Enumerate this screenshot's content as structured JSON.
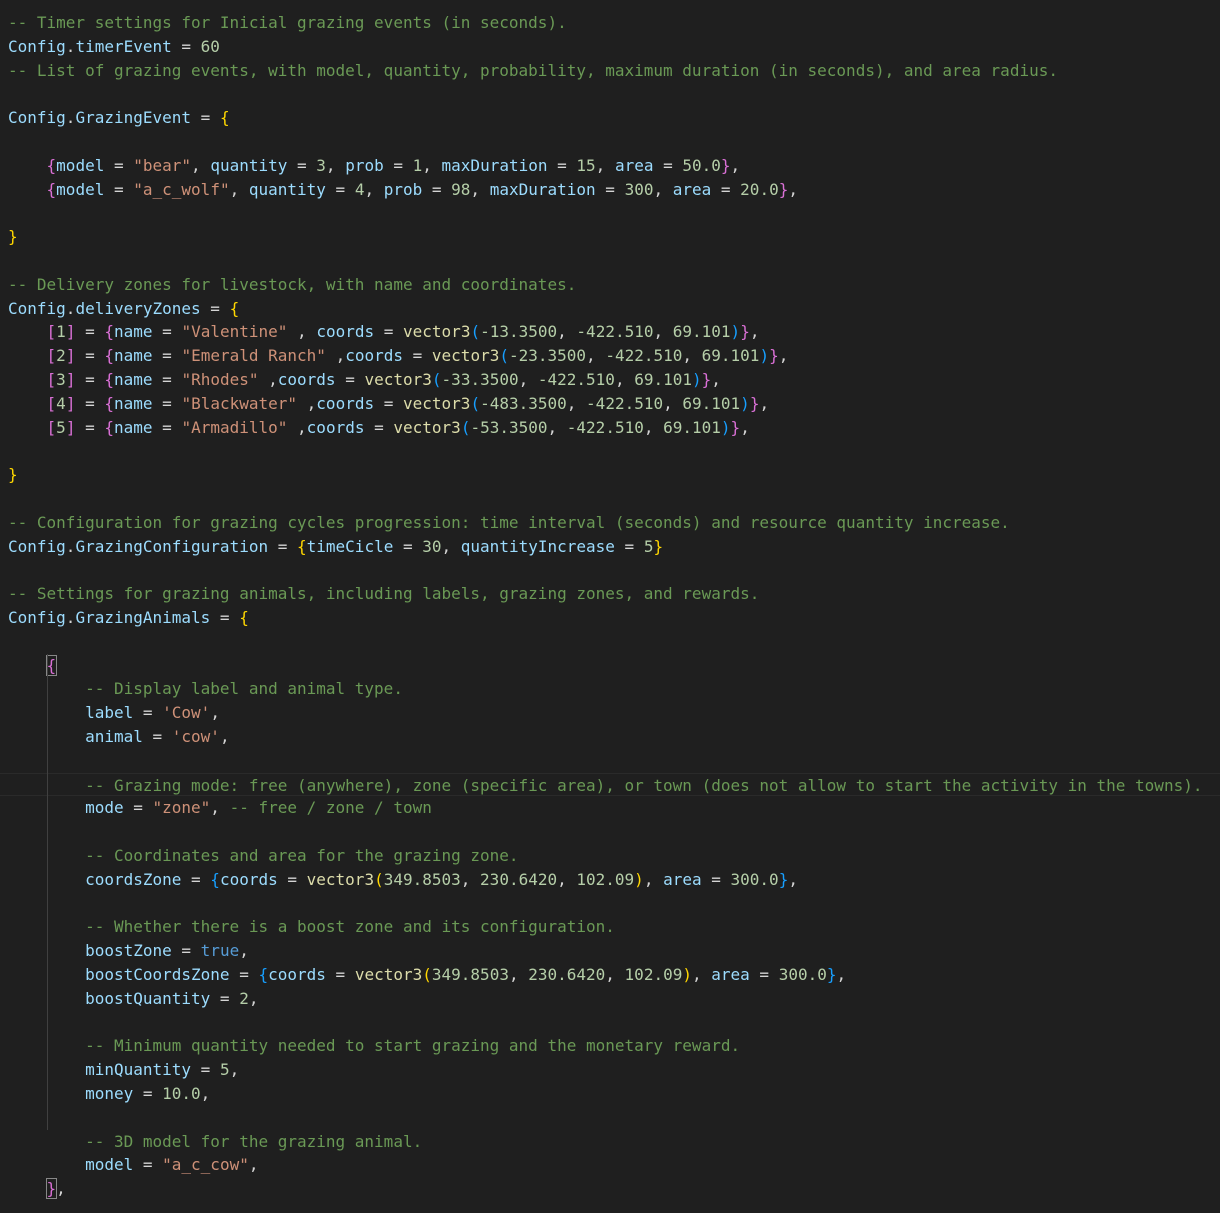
{
  "editor": {
    "theme": {
      "background": "#1f1f1f",
      "comment": "#6a9955",
      "variable": "#9cdcfe",
      "string": "#ce9178",
      "number": "#b5cea8",
      "function": "#dcdcaa",
      "boolean": "#569cd6",
      "bracket1": "#ffd700",
      "bracket2": "#da70d6",
      "bracket3": "#179fff"
    },
    "lines": [
      [
        [
          "comment",
          "-- Timer settings for Inicial grazing events (in seconds)."
        ]
      ],
      [
        [
          "var",
          "Config"
        ],
        [
          "op",
          "."
        ],
        [
          "prop",
          "timerEvent"
        ],
        [
          "op",
          " = "
        ],
        [
          "num",
          "60"
        ]
      ],
      [
        [
          "comment",
          "-- List of grazing events, with model, quantity, probability, maximum duration (in seconds), and area radius."
        ]
      ],
      [],
      [
        [
          "var",
          "Config"
        ],
        [
          "op",
          "."
        ],
        [
          "prop",
          "GrazingEvent"
        ],
        [
          "op",
          " = "
        ],
        [
          "b1",
          "{"
        ]
      ],
      [],
      [
        [
          "op",
          "    "
        ],
        [
          "b2",
          "{"
        ],
        [
          "prop",
          "model"
        ],
        [
          "op",
          " = "
        ],
        [
          "str",
          "\"bear\""
        ],
        [
          "op",
          ", "
        ],
        [
          "prop",
          "quantity"
        ],
        [
          "op",
          " = "
        ],
        [
          "num",
          "3"
        ],
        [
          "op",
          ", "
        ],
        [
          "prop",
          "prob"
        ],
        [
          "op",
          " = "
        ],
        [
          "num",
          "1"
        ],
        [
          "op",
          ", "
        ],
        [
          "prop",
          "maxDuration"
        ],
        [
          "op",
          " = "
        ],
        [
          "num",
          "15"
        ],
        [
          "op",
          ", "
        ],
        [
          "prop",
          "area"
        ],
        [
          "op",
          " = "
        ],
        [
          "num",
          "50.0"
        ],
        [
          "b2",
          "}"
        ],
        [
          "op",
          ","
        ]
      ],
      [
        [
          "op",
          "    "
        ],
        [
          "b2",
          "{"
        ],
        [
          "prop",
          "model"
        ],
        [
          "op",
          " = "
        ],
        [
          "str",
          "\"a_c_wolf\""
        ],
        [
          "op",
          ", "
        ],
        [
          "prop",
          "quantity"
        ],
        [
          "op",
          " = "
        ],
        [
          "num",
          "4"
        ],
        [
          "op",
          ", "
        ],
        [
          "prop",
          "prob"
        ],
        [
          "op",
          " = "
        ],
        [
          "num",
          "98"
        ],
        [
          "op",
          ", "
        ],
        [
          "prop",
          "maxDuration"
        ],
        [
          "op",
          " = "
        ],
        [
          "num",
          "300"
        ],
        [
          "op",
          ", "
        ],
        [
          "prop",
          "area"
        ],
        [
          "op",
          " = "
        ],
        [
          "num",
          "20.0"
        ],
        [
          "b2",
          "}"
        ],
        [
          "op",
          ","
        ]
      ],
      [],
      [
        [
          "b1",
          "}"
        ]
      ],
      [],
      [
        [
          "comment",
          "-- Delivery zones for livestock, with name and coordinates."
        ]
      ],
      [
        [
          "var",
          "Config"
        ],
        [
          "op",
          "."
        ],
        [
          "prop",
          "deliveryZones"
        ],
        [
          "op",
          " = "
        ],
        [
          "b1",
          "{"
        ]
      ],
      [
        [
          "op",
          "    "
        ],
        [
          "b2",
          "["
        ],
        [
          "num",
          "1"
        ],
        [
          "b2",
          "]"
        ],
        [
          "op",
          " = "
        ],
        [
          "b2",
          "{"
        ],
        [
          "prop",
          "name"
        ],
        [
          "op",
          " = "
        ],
        [
          "str",
          "\"Valentine\""
        ],
        [
          "op",
          " , "
        ],
        [
          "prop",
          "coords"
        ],
        [
          "op",
          " = "
        ],
        [
          "func",
          "vector3"
        ],
        [
          "b3",
          "("
        ],
        [
          "num",
          "-13.3500"
        ],
        [
          "op",
          ", "
        ],
        [
          "num",
          "-422.510"
        ],
        [
          "op",
          ", "
        ],
        [
          "num",
          "69.101"
        ],
        [
          "b3",
          ")"
        ],
        [
          "b2",
          "}"
        ],
        [
          "op",
          ","
        ]
      ],
      [
        [
          "op",
          "    "
        ],
        [
          "b2",
          "["
        ],
        [
          "num",
          "2"
        ],
        [
          "b2",
          "]"
        ],
        [
          "op",
          " = "
        ],
        [
          "b2",
          "{"
        ],
        [
          "prop",
          "name"
        ],
        [
          "op",
          " = "
        ],
        [
          "str",
          "\"Emerald Ranch\""
        ],
        [
          "op",
          " ,"
        ],
        [
          "prop",
          "coords"
        ],
        [
          "op",
          " = "
        ],
        [
          "func",
          "vector3"
        ],
        [
          "b3",
          "("
        ],
        [
          "num",
          "-23.3500"
        ],
        [
          "op",
          ", "
        ],
        [
          "num",
          "-422.510"
        ],
        [
          "op",
          ", "
        ],
        [
          "num",
          "69.101"
        ],
        [
          "b3",
          ")"
        ],
        [
          "b2",
          "}"
        ],
        [
          "op",
          ","
        ]
      ],
      [
        [
          "op",
          "    "
        ],
        [
          "b2",
          "["
        ],
        [
          "num",
          "3"
        ],
        [
          "b2",
          "]"
        ],
        [
          "op",
          " = "
        ],
        [
          "b2",
          "{"
        ],
        [
          "prop",
          "name"
        ],
        [
          "op",
          " = "
        ],
        [
          "str",
          "\"Rhodes\""
        ],
        [
          "op",
          " ,"
        ],
        [
          "prop",
          "coords"
        ],
        [
          "op",
          " = "
        ],
        [
          "func",
          "vector3"
        ],
        [
          "b3",
          "("
        ],
        [
          "num",
          "-33.3500"
        ],
        [
          "op",
          ", "
        ],
        [
          "num",
          "-422.510"
        ],
        [
          "op",
          ", "
        ],
        [
          "num",
          "69.101"
        ],
        [
          "b3",
          ")"
        ],
        [
          "b2",
          "}"
        ],
        [
          "op",
          ","
        ]
      ],
      [
        [
          "op",
          "    "
        ],
        [
          "b2",
          "["
        ],
        [
          "num",
          "4"
        ],
        [
          "b2",
          "]"
        ],
        [
          "op",
          " = "
        ],
        [
          "b2",
          "{"
        ],
        [
          "prop",
          "name"
        ],
        [
          "op",
          " = "
        ],
        [
          "str",
          "\"Blackwater\""
        ],
        [
          "op",
          " ,"
        ],
        [
          "prop",
          "coords"
        ],
        [
          "op",
          " = "
        ],
        [
          "func",
          "vector3"
        ],
        [
          "b3",
          "("
        ],
        [
          "num",
          "-483.3500"
        ],
        [
          "op",
          ", "
        ],
        [
          "num",
          "-422.510"
        ],
        [
          "op",
          ", "
        ],
        [
          "num",
          "69.101"
        ],
        [
          "b3",
          ")"
        ],
        [
          "b2",
          "}"
        ],
        [
          "op",
          ","
        ]
      ],
      [
        [
          "op",
          "    "
        ],
        [
          "b2",
          "["
        ],
        [
          "num",
          "5"
        ],
        [
          "b2",
          "]"
        ],
        [
          "op",
          " = "
        ],
        [
          "b2",
          "{"
        ],
        [
          "prop",
          "name"
        ],
        [
          "op",
          " = "
        ],
        [
          "str",
          "\"Armadillo\""
        ],
        [
          "op",
          " ,"
        ],
        [
          "prop",
          "coords"
        ],
        [
          "op",
          " = "
        ],
        [
          "func",
          "vector3"
        ],
        [
          "b3",
          "("
        ],
        [
          "num",
          "-53.3500"
        ],
        [
          "op",
          ", "
        ],
        [
          "num",
          "-422.510"
        ],
        [
          "op",
          ", "
        ],
        [
          "num",
          "69.101"
        ],
        [
          "b3",
          ")"
        ],
        [
          "b2",
          "}"
        ],
        [
          "op",
          ","
        ]
      ],
      [],
      [
        [
          "b1",
          "}"
        ]
      ],
      [],
      [
        [
          "comment",
          "-- Configuration for grazing cycles progression: time interval (seconds) and resource quantity increase."
        ]
      ],
      [
        [
          "var",
          "Config"
        ],
        [
          "op",
          "."
        ],
        [
          "prop",
          "GrazingConfiguration"
        ],
        [
          "op",
          " = "
        ],
        [
          "b1",
          "{"
        ],
        [
          "prop",
          "timeCicle"
        ],
        [
          "op",
          " = "
        ],
        [
          "num",
          "30"
        ],
        [
          "op",
          ", "
        ],
        [
          "prop",
          "quantityIncrease"
        ],
        [
          "op",
          " = "
        ],
        [
          "num",
          "5"
        ],
        [
          "b1",
          "}"
        ]
      ],
      [],
      [
        [
          "comment",
          "-- Settings for grazing animals, including labels, grazing zones, and rewards."
        ]
      ],
      [
        [
          "var",
          "Config"
        ],
        [
          "op",
          "."
        ],
        [
          "prop",
          "GrazingAnimals"
        ],
        [
          "op",
          " = "
        ],
        [
          "b1",
          "{"
        ]
      ],
      [],
      [
        [
          "op",
          "    "
        ],
        [
          "b2box",
          "{"
        ]
      ],
      [
        [
          "op",
          "        "
        ],
        [
          "comment",
          "-- Display label and animal type."
        ]
      ],
      [
        [
          "op",
          "        "
        ],
        [
          "prop",
          "label"
        ],
        [
          "op",
          " = "
        ],
        [
          "str",
          "'Cow'"
        ],
        [
          "op",
          ","
        ]
      ],
      [
        [
          "op",
          "        "
        ],
        [
          "prop",
          "animal"
        ],
        [
          "op",
          " = "
        ],
        [
          "str",
          "'cow'"
        ],
        [
          "op",
          ","
        ]
      ],
      [],
      [
        [
          "op",
          "        "
        ],
        [
          "comment",
          "-- Grazing mode: free (anywhere), zone (specific area), or town (does not allow to start the activity in the towns)."
        ]
      ],
      [
        [
          "op",
          "        "
        ],
        [
          "prop",
          "mode"
        ],
        [
          "op",
          " = "
        ],
        [
          "str",
          "\"zone\""
        ],
        [
          "op",
          ", "
        ],
        [
          "comment",
          "-- free / zone / town"
        ]
      ],
      [],
      [
        [
          "op",
          "        "
        ],
        [
          "comment",
          "-- Coordinates and area for the grazing zone."
        ]
      ],
      [
        [
          "op",
          "        "
        ],
        [
          "prop",
          "coordsZone"
        ],
        [
          "op",
          " = "
        ],
        [
          "b3",
          "{"
        ],
        [
          "prop",
          "coords"
        ],
        [
          "op",
          " = "
        ],
        [
          "func",
          "vector3"
        ],
        [
          "b1",
          "("
        ],
        [
          "num",
          "349.8503"
        ],
        [
          "op",
          ", "
        ],
        [
          "num",
          "230.6420"
        ],
        [
          "op",
          ", "
        ],
        [
          "num",
          "102.09"
        ],
        [
          "b1",
          ")"
        ],
        [
          "op",
          ", "
        ],
        [
          "prop",
          "area"
        ],
        [
          "op",
          " = "
        ],
        [
          "num",
          "300.0"
        ],
        [
          "b3",
          "}"
        ],
        [
          "op",
          ","
        ]
      ],
      [],
      [
        [
          "op",
          "        "
        ],
        [
          "comment",
          "-- Whether there is a boost zone and its configuration."
        ]
      ],
      [
        [
          "op",
          "        "
        ],
        [
          "prop",
          "boostZone"
        ],
        [
          "op",
          " = "
        ],
        [
          "bool",
          "true"
        ],
        [
          "op",
          ","
        ]
      ],
      [
        [
          "op",
          "        "
        ],
        [
          "prop",
          "boostCoordsZone"
        ],
        [
          "op",
          " = "
        ],
        [
          "b3",
          "{"
        ],
        [
          "prop",
          "coords"
        ],
        [
          "op",
          " = "
        ],
        [
          "func",
          "vector3"
        ],
        [
          "b1",
          "("
        ],
        [
          "num",
          "349.8503"
        ],
        [
          "op",
          ", "
        ],
        [
          "num",
          "230.6420"
        ],
        [
          "op",
          ", "
        ],
        [
          "num",
          "102.09"
        ],
        [
          "b1",
          ")"
        ],
        [
          "op",
          ", "
        ],
        [
          "prop",
          "area"
        ],
        [
          "op",
          " = "
        ],
        [
          "num",
          "300.0"
        ],
        [
          "b3",
          "}"
        ],
        [
          "op",
          ","
        ]
      ],
      [
        [
          "op",
          "        "
        ],
        [
          "prop",
          "boostQuantity"
        ],
        [
          "op",
          " = "
        ],
        [
          "num",
          "2"
        ],
        [
          "op",
          ","
        ]
      ],
      [],
      [
        [
          "op",
          "        "
        ],
        [
          "comment",
          "-- Minimum quantity needed to start grazing and the monetary reward."
        ]
      ],
      [
        [
          "op",
          "        "
        ],
        [
          "prop",
          "minQuantity"
        ],
        [
          "op",
          " = "
        ],
        [
          "num",
          "5"
        ],
        [
          "op",
          ","
        ]
      ],
      [
        [
          "op",
          "        "
        ],
        [
          "prop",
          "money"
        ],
        [
          "op",
          " = "
        ],
        [
          "num",
          "10.0"
        ],
        [
          "op",
          ","
        ]
      ],
      [],
      [
        [
          "op",
          "        "
        ],
        [
          "comment",
          "-- 3D model for the grazing animal."
        ]
      ],
      [
        [
          "op",
          "        "
        ],
        [
          "prop",
          "model"
        ],
        [
          "op",
          " = "
        ],
        [
          "str",
          "\"a_c_cow\""
        ],
        [
          "op",
          ","
        ]
      ],
      [
        [
          "op",
          "    "
        ],
        [
          "b2box",
          "}"
        ],
        [
          "op",
          ","
        ]
      ]
    ]
  }
}
